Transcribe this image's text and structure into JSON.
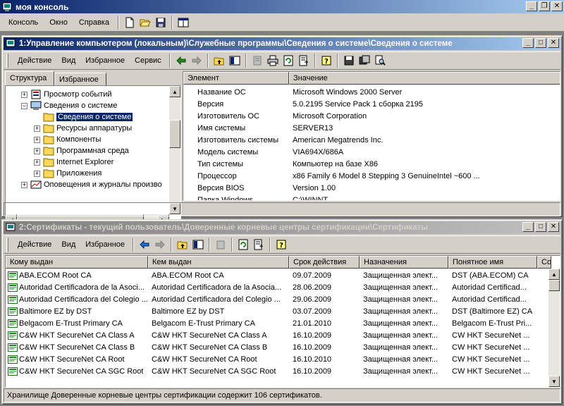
{
  "app": {
    "title": "моя консоль",
    "menu": [
      "Консоль",
      "Окно",
      "Справка"
    ]
  },
  "window1": {
    "title": "1:Управление компьютером (локальным)\\Служебные программы\\Сведения о системе\\Сведения о системе",
    "toolbar_menu": [
      "Действие",
      "Вид",
      "Избранное",
      "Сервис"
    ],
    "tabs": [
      "Структура",
      "Избранное"
    ],
    "tree": [
      {
        "label": "Просмотр событий",
        "level": 1,
        "expander": "+",
        "icon": "event-viewer-icon"
      },
      {
        "label": "Сведения о системе",
        "level": 1,
        "expander": "−",
        "icon": "system-info-icon"
      },
      {
        "label": "Сведения о системе",
        "level": 2,
        "expander": "",
        "icon": "folder-icon",
        "selected": true
      },
      {
        "label": "Ресурсы аппаратуры",
        "level": 2,
        "expander": "+",
        "icon": "folder-icon"
      },
      {
        "label": "Компоненты",
        "level": 2,
        "expander": "+",
        "icon": "folder-icon"
      },
      {
        "label": "Программная среда",
        "level": 2,
        "expander": "+",
        "icon": "folder-icon"
      },
      {
        "label": "Internet Explorer",
        "level": 2,
        "expander": "+",
        "icon": "folder-icon"
      },
      {
        "label": "Приложения",
        "level": 2,
        "expander": "+",
        "icon": "folder-icon"
      },
      {
        "label": "Оповещения и журналы произво",
        "level": 1,
        "expander": "+",
        "icon": "alerts-icon"
      }
    ],
    "columns": [
      "Элемент",
      "Значение"
    ],
    "rows": [
      [
        "Название ОС",
        "Microsoft Windows 2000 Server"
      ],
      [
        "Версия",
        "5.0.2195 Service Pack 1 сборка 2195"
      ],
      [
        "Изготовитель ОС",
        "Microsoft Corporation"
      ],
      [
        "Имя системы",
        "SERVER13"
      ],
      [
        "Изготовитель системы",
        "American Megatrends Inc."
      ],
      [
        "Модель системы",
        "VIA694X/686A"
      ],
      [
        "Тип системы",
        "Компьютер на базе X86"
      ],
      [
        "Процессор",
        "x86 Family 6 Model 8 Stepping 3 GenuineIntel ~600 ..."
      ],
      [
        "Версия BIOS",
        "Version 1.00"
      ],
      [
        "Папка Windows",
        "C:\\WINNT"
      ]
    ]
  },
  "window2": {
    "title": "2:Сертификаты - текущий пользователь\\Доверенные корневые центры сертификации\\Сертификаты",
    "toolbar_menu": [
      "Действие",
      "Вид",
      "Избранное"
    ],
    "columns": [
      "Кому выдан",
      "Кем выдан",
      "Срок действия",
      "Назначения",
      "Понятное имя",
      "Со"
    ],
    "rows": [
      [
        "ABA.ECOM Root CA",
        "ABA.ECOM Root CA",
        "09.07.2009",
        "Защищенная элект...",
        "DST (ABA.ECOM) CA"
      ],
      [
        "Autoridad Certificadora de la Asoci...",
        "Autoridad Certificadora de la Asocia...",
        "28.06.2009",
        "Защищенная элект...",
        "Autoridad Certificad..."
      ],
      [
        "Autoridad Certificadora del Colegio ...",
        "Autoridad Certificadora del Colegio ...",
        "29.06.2009",
        "Защищенная элект...",
        "Autoridad Certificad..."
      ],
      [
        "Baltimore EZ by DST",
        "Baltimore EZ by DST",
        "03.07.2009",
        "Защищенная элект...",
        "DST (Baltimore EZ) CA"
      ],
      [
        "Belgacom E-Trust Primary CA",
        "Belgacom E-Trust Primary CA",
        "21.01.2010",
        "Защищенная элект...",
        "Belgacom E-Trust Pri..."
      ],
      [
        "C&W HKT SecureNet CA Class A",
        "C&W HKT SecureNet CA Class A",
        "16.10.2009",
        "Защищенная элект...",
        "CW HKT SecureNet ..."
      ],
      [
        "C&W HKT SecureNet CA Class B",
        "C&W HKT SecureNet CA Class B",
        "16.10.2009",
        "Защищенная элект...",
        "CW HKT SecureNet ..."
      ],
      [
        "C&W HKT SecureNet CA Root",
        "C&W HKT SecureNet CA Root",
        "16.10.2010",
        "Защищенная элект...",
        "CW HKT SecureNet ..."
      ],
      [
        "C&W HKT SecureNet CA SGC Root",
        "C&W HKT SecureNet CA SGC Root",
        "16.10.2009",
        "Защищенная элект...",
        "CW HKT SecureNet ..."
      ]
    ],
    "status": "Хранилище Доверенные корневые центры сертификации содержит 106 сертификатов."
  },
  "colors": {
    "active_title_start": "#0a246a",
    "active_title_end": "#a6caf0",
    "inactive_title_start": "#808080",
    "inactive_title_end": "#c0c0c0",
    "face": "#d4d0c8"
  }
}
